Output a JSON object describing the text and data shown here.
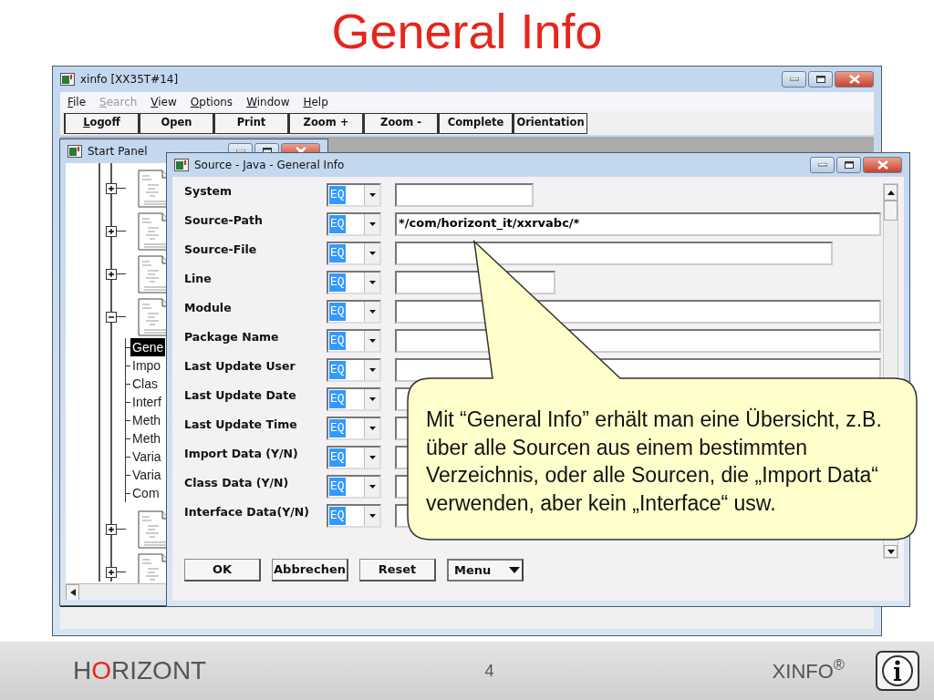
{
  "slide_title": "General Info",
  "main_window": {
    "title": "xinfo [XX35T#14]",
    "menu": [
      {
        "label": "File",
        "disabled": false
      },
      {
        "label": "Search",
        "disabled": true
      },
      {
        "label": "View",
        "disabled": false
      },
      {
        "label": "Options",
        "disabled": false
      },
      {
        "label": "Window",
        "disabled": false
      },
      {
        "label": "Help",
        "disabled": false
      }
    ],
    "toolbar": [
      "Logoff",
      "Open",
      "Print",
      "Zoom +",
      "Zoom -",
      "Complete",
      "Orientation"
    ]
  },
  "start_panel": {
    "title": "Start Panel",
    "tree": [
      {
        "expanded": false
      },
      {
        "expanded": false
      },
      {
        "expanded": false
      },
      {
        "expanded": true,
        "children": [
          {
            "label": "Gene",
            "selected": true
          },
          {
            "label": "Impo",
            "selected": false
          },
          {
            "label": "Clas",
            "selected": false
          },
          {
            "label": "Interf",
            "selected": false
          },
          {
            "label": "Meth",
            "selected": false
          },
          {
            "label": "Meth",
            "selected": false
          },
          {
            "label": "Varia",
            "selected": false
          },
          {
            "label": "Varia",
            "selected": false
          },
          {
            "label": "Com",
            "selected": false
          }
        ]
      },
      {
        "expanded": false
      },
      {
        "expanded": false
      }
    ]
  },
  "dialog": {
    "title": "Source - Java - General Info",
    "fields": [
      {
        "label": "System",
        "operator": "EQ"
      },
      {
        "label": "Source-Path",
        "operator": "EQ",
        "value": "*/com/horizont_it/xxrvabc/*"
      },
      {
        "label": "Source-File",
        "operator": "EQ"
      },
      {
        "label": "Line",
        "operator": "EQ"
      },
      {
        "label": "Module",
        "operator": "EQ"
      },
      {
        "label": "Package Name",
        "operator": "EQ"
      },
      {
        "label": "Last Update User",
        "operator": "EQ"
      },
      {
        "label": "Last Update Date",
        "operator": "EQ"
      },
      {
        "label": "Last Update Time",
        "operator": "EQ"
      },
      {
        "label": "Import Data (Y/N)",
        "operator": "EQ"
      },
      {
        "label": "Class Data (Y/N)",
        "operator": "EQ"
      },
      {
        "label": "Interface Data(Y/N)",
        "operator": "EQ"
      }
    ],
    "buttons": [
      {
        "label": "OK",
        "kind": "button"
      },
      {
        "label": "Abbrechen",
        "kind": "button"
      },
      {
        "label": "Reset",
        "kind": "button"
      },
      {
        "label": "Menu",
        "kind": "menu"
      }
    ]
  },
  "callout": {
    "text": "Mit “General Info” erhält man eine Übersicht, z.B. über alle Sourcen aus einem bestimmten Verzeichnis, oder alle Sourcen, die „Import Data“ verwenden, aber kein „Interface“ usw."
  },
  "footer": {
    "logo": [
      {
        "text": "H",
        "color": "#555555"
      },
      {
        "text": "O",
        "color": "#e8251b"
      },
      {
        "text": "RIZONT",
        "color": "#555555"
      }
    ],
    "page": "4",
    "product": "XINFO$^{®}$"
  }
}
